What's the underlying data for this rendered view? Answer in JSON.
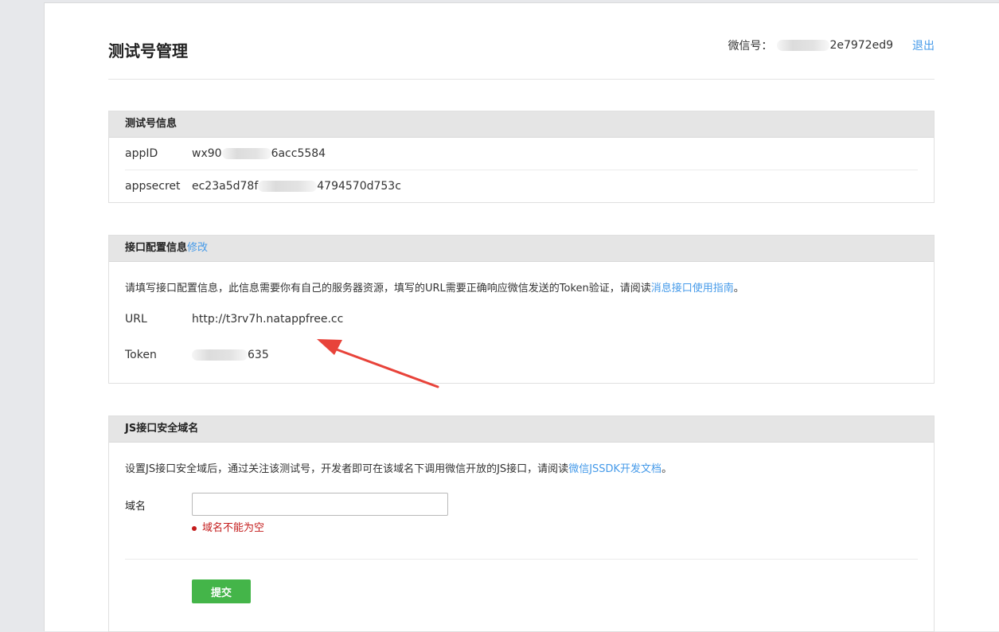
{
  "header": {
    "title": "测试号管理",
    "wechat_label": "微信号：",
    "wechat_id_suffix": "2e7972ed9",
    "logout": "退出"
  },
  "test_info": {
    "title": "测试号信息",
    "appid_label": "appID",
    "appid_prefix": "wx90",
    "appid_suffix": "6acc5584",
    "appsecret_label": "appsecret",
    "appsecret_prefix": "ec23a5d78f",
    "appsecret_suffix": "4794570d753c"
  },
  "interface_config": {
    "title": "接口配置信息",
    "edit_link": "修改",
    "desc_text": "请填写接口配置信息，此信息需要你有自己的服务器资源，填写的URL需要正确响应微信发送的Token验证，请阅读",
    "desc_link": "消息接口使用指南",
    "desc_end": "。",
    "url_label": "URL",
    "url_value": "http://t3rv7h.natappfree.cc",
    "token_label": "Token",
    "token_suffix": "635"
  },
  "js_domain": {
    "title": "JS接口安全域名",
    "desc_text": "设置JS接口安全域后，通过关注该测试号，开发者即可在该域名下调用微信开放的JS接口，请阅读",
    "desc_link": "微信JSSDK开发文档",
    "desc_end": "。",
    "domain_label": "域名",
    "domain_value": "",
    "error": "域名不能为空",
    "submit": "提交"
  },
  "colors": {
    "accent_link": "#459ae9",
    "submit_green": "#44b549",
    "error_red": "#c41c1c",
    "annotation_arrow": "#e8433a"
  }
}
